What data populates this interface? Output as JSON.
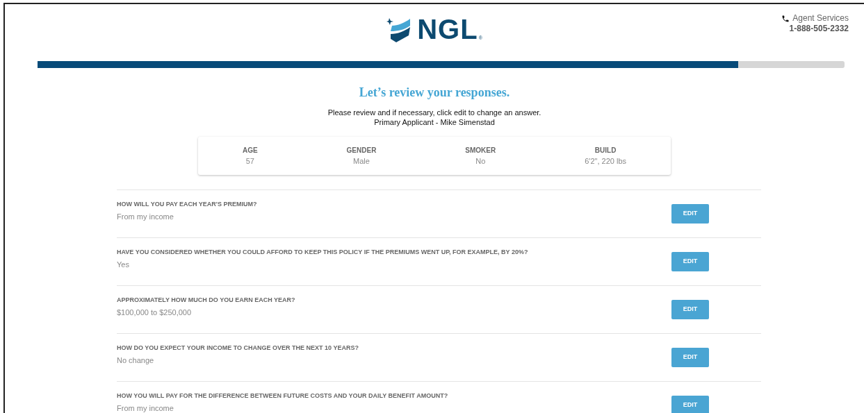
{
  "header": {
    "logo_text": "NGL",
    "logo_mark": "®",
    "contact_label": "Agent Services",
    "contact_phone": "1-888-505-2332"
  },
  "progress": {
    "level": 0.868
  },
  "intro": {
    "title": "Let’s review your responses.",
    "instructions": "Please review and if necessary, click edit to change an answer.",
    "applicant": "Primary Applicant - Mike Simenstad"
  },
  "summary": [
    {
      "label": "AGE",
      "value": "57"
    },
    {
      "label": "GENDER",
      "value": "Male"
    },
    {
      "label": "SMOKER",
      "value": "No"
    },
    {
      "label": "BUILD",
      "value": "6'2\", 220 lbs"
    }
  ],
  "questions": [
    {
      "question": "HOW WILL YOU PAY EACH YEAR'S PREMIUM?",
      "answer": "From my income",
      "button": "EDIT"
    },
    {
      "question": "HAVE YOU CONSIDERED WHETHER YOU COULD AFFORD TO KEEP THIS POLICY IF THE PREMIUMS WENT UP, FOR EXAMPLE, BY 20%?",
      "answer": "Yes",
      "button": "EDIT"
    },
    {
      "question": "APPROXIMATELY HOW MUCH DO YOU EARN EACH YEAR?",
      "answer": "$100,000 to $250,000",
      "button": "EDIT"
    },
    {
      "question": "HOW DO YOU EXPECT YOUR INCOME TO CHANGE OVER THE NEXT 10 YEARS?",
      "answer": "No change",
      "button": "EDIT"
    },
    {
      "question": "HOW YOU WILL PAY FOR THE DIFFERENCE BETWEEN FUTURE COSTS AND YOUR DAILY BENEFIT AMOUNT?",
      "answer": "From my income",
      "button": "EDIT"
    }
  ]
}
